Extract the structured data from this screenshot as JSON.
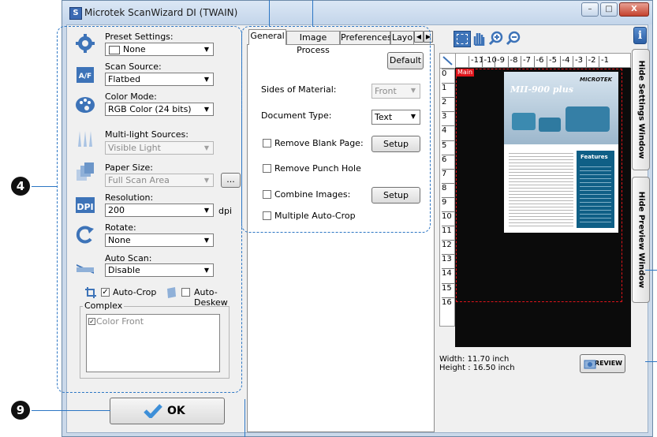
{
  "window": {
    "title": "Microtek ScanWizard DI (TWAIN)",
    "minimize": "–",
    "maximize": "□",
    "close": "X"
  },
  "settings": {
    "preset": {
      "label": "Preset Settings:",
      "value": "None"
    },
    "scan_source": {
      "label": "Scan Source:",
      "value": "Flatbed"
    },
    "color_mode": {
      "label": "Color Mode:",
      "value": "RGB Color (24 bits)"
    },
    "multilight": {
      "label": "Multi-light Sources:",
      "value": "Visible Light"
    },
    "paper_size": {
      "label": "Paper Size:",
      "value": "Full Scan Area",
      "more": "..."
    },
    "resolution": {
      "label": "Resolution:",
      "value": "200",
      "unit": "dpi"
    },
    "rotate": {
      "label": "Rotate:",
      "value": "None"
    },
    "auto_scan": {
      "label": "Auto Scan:",
      "value": "Disable"
    },
    "auto_crop": {
      "label": "Auto-Crop",
      "checked": true
    },
    "auto_deskew": {
      "label": "Auto-Deskew",
      "checked": false
    },
    "complex": {
      "label": "Complex",
      "items": [
        {
          "label": "Color Front",
          "checked": true
        }
      ]
    }
  },
  "ok_label": "OK",
  "tabs": [
    "General",
    "Image Process",
    "Preferences",
    "Layo"
  ],
  "tab_scroll": {
    "left": "◀",
    "right": "▶"
  },
  "general": {
    "default_label": "Default",
    "sides": {
      "label": "Sides of Material:",
      "value": "Front"
    },
    "doc_type": {
      "label": "Document Type:",
      "value": "Text"
    },
    "remove_blank": {
      "label": "Remove Blank Page:",
      "button": "Setup"
    },
    "remove_punch": {
      "label": "Remove Punch Hole"
    },
    "combine": {
      "label": "Combine Images:",
      "button": "Setup"
    },
    "multi_autocrop": {
      "label": "Multiple Auto-Crop"
    }
  },
  "preview": {
    "ruler_x": [
      "-11",
      "-10",
      "-9",
      "-8",
      "-7",
      "-6",
      "-5",
      "-4",
      "-3",
      "-2",
      "-1"
    ],
    "ruler_y": [
      "0",
      "1",
      "2",
      "3",
      "4",
      "5",
      "6",
      "7",
      "8",
      "9",
      "10",
      "11",
      "12",
      "13",
      "14",
      "15",
      "16"
    ],
    "main_label": "Main",
    "width_text": "Width: 11.70 inch",
    "height_text": "Height : 16.50 inch",
    "preview_label": "PREVIEW"
  },
  "document": {
    "brand": "MICROTEK",
    "product": "MII-900 plus",
    "features_heading": "Features"
  },
  "side_buttons": {
    "hide_settings": "Hide Settings Window",
    "hide_preview": "Hide Preview Window",
    "info": "i"
  },
  "callouts": {
    "four": "4",
    "nine": "9"
  },
  "colors": {
    "accent": "#2c76c4",
    "selection": "#e0141b",
    "titlebar": "#c3d5ea"
  }
}
